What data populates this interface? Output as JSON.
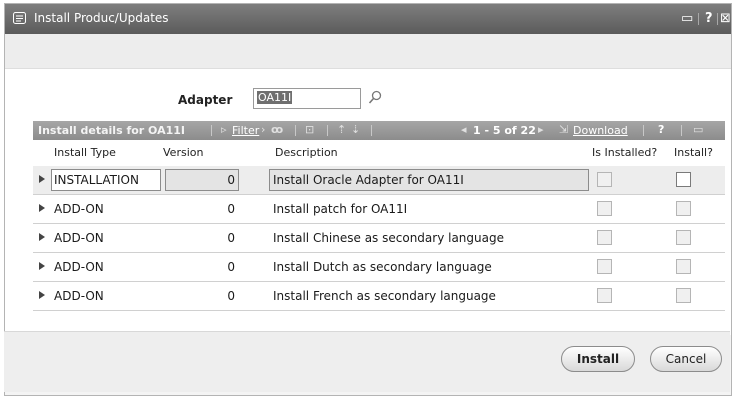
{
  "window": {
    "title": "Install Produc/Updates",
    "controls": {
      "maximize_glyph": "▭",
      "help_glyph": "?",
      "close_glyph": "⊠"
    }
  },
  "adapter": {
    "label": "Adapter",
    "value": "OA11I"
  },
  "grid": {
    "header_title": "Install details for OA11I",
    "filter_label": "Filter",
    "pager_text": "1 - 5 of 22",
    "download_label": "Download",
    "help_glyph": "?",
    "columns": [
      "Install Type",
      "Version",
      "Description",
      "Is Installed?",
      "Install?"
    ],
    "rows": [
      {
        "type": "INSTALLATION",
        "version": "0",
        "description": "Install Oracle Adapter for OA11I",
        "is_installed": false,
        "install": false
      },
      {
        "type": "ADD-ON",
        "version": "0",
        "description": "Install patch for OA11I",
        "is_installed": false,
        "install": false
      },
      {
        "type": "ADD-ON",
        "version": "0",
        "description": "Install Chinese as secondary language",
        "is_installed": false,
        "install": false
      },
      {
        "type": "ADD-ON",
        "version": "0",
        "description": "Install Dutch as secondary language",
        "is_installed": false,
        "install": false
      },
      {
        "type": "ADD-ON",
        "version": "0",
        "description": "Install French as secondary language",
        "is_installed": false,
        "install": false
      }
    ]
  },
  "buttons": {
    "install": "Install",
    "cancel": "Cancel"
  },
  "icons": {
    "app": "window-icon",
    "lookup": "search-icon",
    "filter": "filter-icon",
    "binoculars": "find-icon",
    "expand": "expand-icon",
    "prev": "prev-page-icon",
    "next": "next-page-icon",
    "download": "download-icon",
    "maximize": "maximize-icon"
  },
  "colors": {
    "titlebar": "#6a6a6a",
    "grid_header": "#9a9a9a",
    "selection": "#6f6f6f"
  }
}
